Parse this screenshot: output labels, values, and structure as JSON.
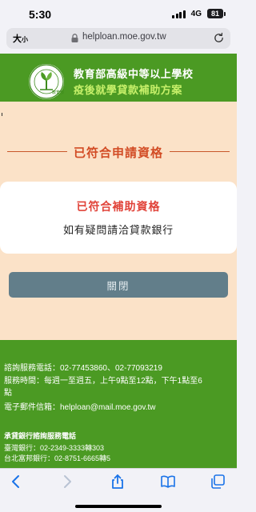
{
  "status_bar": {
    "time": "5:30",
    "network": "4G",
    "battery": "81"
  },
  "browser": {
    "text_size_label_big": "大",
    "text_size_label_small": "小",
    "url": "helploan.moe.gov.tw"
  },
  "header": {
    "title_line1": "教育部高級中等以上學校",
    "title_line2": "疫後就學貸款補助方案",
    "logo_text": "教育部"
  },
  "main": {
    "section_title": "已符合申請資格",
    "card_title": "已符合補助資格",
    "card_text": "如有疑問請洽貸款銀行",
    "close_button": "關閉"
  },
  "footer": {
    "phone": "諮詢服務電話：02-77453860、02-77093219",
    "hours_1": "服務時間：每週一至週五，上午9點至12點，下午1點至6",
    "hours_2": "點",
    "email": "電子郵件信箱：helploan@mail.moe.gov.tw",
    "bank_heading": "承貸銀行諮詢服務電話",
    "bank_1": "臺灣銀行：02-2349-3333轉303",
    "bank_2": "台北富邦銀行：02-8751-6665轉5"
  },
  "colors": {
    "brand_green": "#4b9a23",
    "accent_red": "#e1443a",
    "section_bg": "#fbe2c8",
    "button": "#627e8a"
  }
}
